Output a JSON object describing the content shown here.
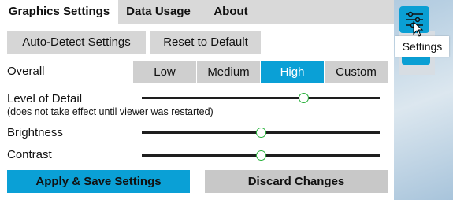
{
  "tabs": [
    {
      "label": "Graphics Settings",
      "active": true
    },
    {
      "label": "Data Usage",
      "active": false
    },
    {
      "label": "About",
      "active": false
    }
  ],
  "actions": {
    "auto_detect": "Auto-Detect Settings",
    "reset": "Reset to Default"
  },
  "overall": {
    "label": "Overall",
    "options": [
      "Low",
      "Medium",
      "High",
      "Custom"
    ],
    "selected": "High"
  },
  "sliders": {
    "level_of_detail": {
      "label": "Level of Detail",
      "note": "(does not take effect until viewer was restarted)",
      "value": 0.68
    },
    "brightness": {
      "label": "Brightness",
      "value": 0.5
    },
    "contrast": {
      "label": "Contrast",
      "value": 0.5
    }
  },
  "footer": {
    "apply": "Apply & Save Settings",
    "discard": "Discard Changes"
  },
  "sidebar": {
    "tooltip": "Settings",
    "icon": "settings-sliders-icon"
  },
  "colors": {
    "accent": "#0aa0d6",
    "thumb_border": "#29b23c",
    "button_gray": "#d6d6d6"
  }
}
